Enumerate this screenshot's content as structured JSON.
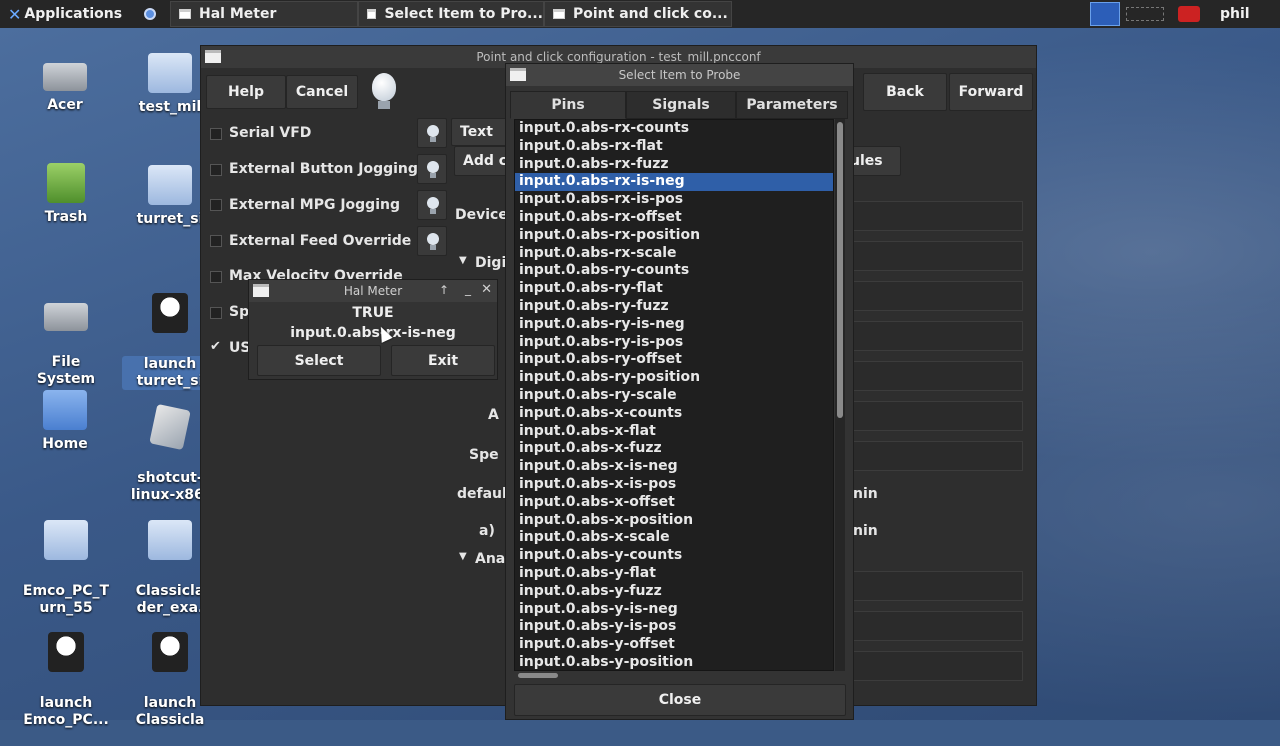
{
  "panel": {
    "applications_label": "Applications",
    "tasks": [
      "Hal Meter",
      "Select Item to Pro...",
      "Point and click co..."
    ],
    "user": "phil"
  },
  "desktop": {
    "col1": [
      "Acer",
      "Trash",
      "File\nSystem",
      "Home",
      "Emco_PC_T\nurn_55",
      "launch\nEmco_PC..."
    ],
    "col2": [
      "test_mil",
      "turret_si",
      "launch\nturret_si",
      "shotcut-\nlinux-x86.",
      "Classicla\nder_exa.",
      "launch\nClassicla"
    ]
  },
  "pncconf": {
    "title": "Point and click configuration - test_mill.pncconf",
    "help": "Help",
    "cancel": "Cancel",
    "back": "Back",
    "forward": "Forward",
    "options": [
      {
        "label": "Serial VFD",
        "checked": false
      },
      {
        "label": "External Button Jogging",
        "checked": false
      },
      {
        "label": "External MPG Jogging",
        "checked": false
      },
      {
        "label": "External Feed Override",
        "checked": false
      },
      {
        "label": "Max Velocity Override",
        "checked": false
      },
      {
        "label": "Sp",
        "checked": false
      },
      {
        "label": "US",
        "checked": true
      }
    ],
    "right_fragments": {
      "text": "Text",
      "add": "Add c",
      "device": "Device",
      "digi": "Digi",
      "a": "A",
      "spe": "Spe",
      "defaul": "defaul",
      "a2": "a)",
      "ana": "Ana",
      "ules": "ules",
      "nin1": "nin",
      "nin2": "nin"
    }
  },
  "probe": {
    "title": "Select Item to Probe",
    "tabs": [
      "Pins",
      "Signals",
      "Parameters"
    ],
    "items": [
      "input.0.abs-rx-counts",
      "input.0.abs-rx-flat",
      "input.0.abs-rx-fuzz",
      "input.0.abs-rx-is-neg",
      "input.0.abs-rx-is-pos",
      "input.0.abs-rx-offset",
      "input.0.abs-rx-position",
      "input.0.abs-rx-scale",
      "input.0.abs-ry-counts",
      "input.0.abs-ry-flat",
      "input.0.abs-ry-fuzz",
      "input.0.abs-ry-is-neg",
      "input.0.abs-ry-is-pos",
      "input.0.abs-ry-offset",
      "input.0.abs-ry-position",
      "input.0.abs-ry-scale",
      "input.0.abs-x-counts",
      "input.0.abs-x-flat",
      "input.0.abs-x-fuzz",
      "input.0.abs-x-is-neg",
      "input.0.abs-x-is-pos",
      "input.0.abs-x-offset",
      "input.0.abs-x-position",
      "input.0.abs-x-scale",
      "input.0.abs-y-counts",
      "input.0.abs-y-flat",
      "input.0.abs-y-fuzz",
      "input.0.abs-y-is-neg",
      "input.0.abs-y-is-pos",
      "input.0.abs-y-offset",
      "input.0.abs-y-position"
    ],
    "selected": "input.0.abs-rx-is-neg",
    "close": "Close"
  },
  "halmeter": {
    "title": "Hal Meter",
    "value": "TRUE",
    "pin": "input.0.abs-rx-is-neg",
    "select": "Select",
    "exit": "Exit"
  },
  "colors": {
    "selection": "#2f5fa8",
    "window_bg": "#2e2e2e",
    "panel_bg": "#262626"
  }
}
